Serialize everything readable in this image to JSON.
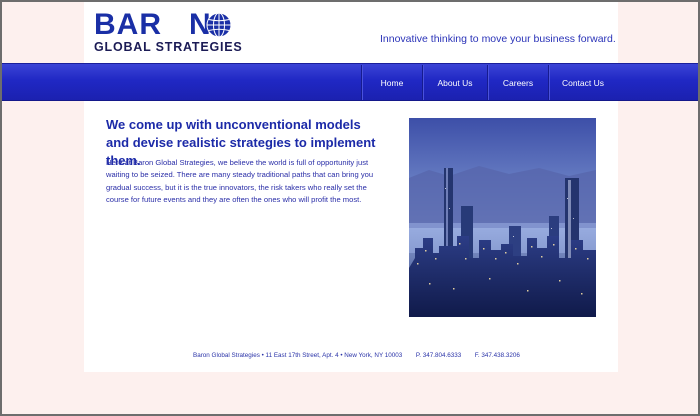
{
  "brand": {
    "name": "BARON",
    "subtitle": "GLOBAL STRATEGIES",
    "tagline": "Innovative thinking to move your business forward.",
    "color": "#1a2fa6"
  },
  "nav": {
    "items": [
      {
        "label": "Home"
      },
      {
        "label": "About Us"
      },
      {
        "label": "Careers"
      },
      {
        "label": "Contact Us"
      }
    ],
    "bar_color": "#2028c4"
  },
  "main": {
    "headline": "We come up with unconventional models and devise realistic strategies to implement them.",
    "body": "Here at Baron Global Strategies, we believe the world is full of opportunity just waiting to be seized. There are many steady traditional paths that can bring you gradual success, but it is the true innovators, the risk takers who really set the course for future events and they are often the ones who will profit the most.",
    "image": "city-skyline-night-photo"
  },
  "footer": {
    "address": "Baron Global Strategies • 11 East 17th Street, Apt. 4 • New York, NY 10003",
    "phone": "P. 347.804.6333",
    "fax": "F. 347.438.3206"
  }
}
